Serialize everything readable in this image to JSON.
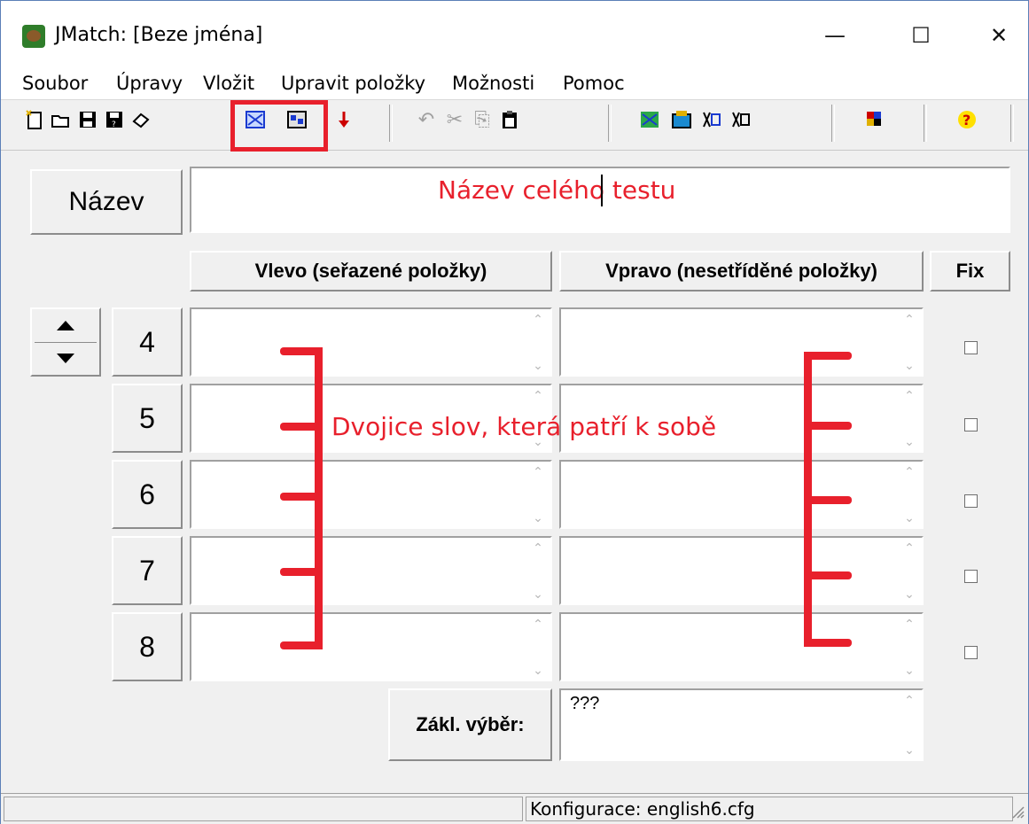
{
  "window": {
    "title": "JMatch: [Beze jména]",
    "minimize_glyph": "—",
    "maximize_glyph": "☐",
    "close_glyph": "✕"
  },
  "menu": [
    "Soubor",
    "Úpravy",
    "Vložit",
    "Upravit položky",
    "Možnosti",
    "Pomoc"
  ],
  "toolbar": {
    "icons": [
      "new-file-icon",
      "open-folder-icon",
      "save-icon",
      "save-as-icon",
      "eraser-icon",
      "create-web-page-icon",
      "create-web-page-alt-icon",
      "down-arrow-icon",
      "undo-icon",
      "cut-icon",
      "copy-icon",
      "paste-icon",
      "web-export-icon",
      "image-icon",
      "export-icon",
      "export-alt-icon",
      "config-icon",
      "help-icon"
    ]
  },
  "title_row": {
    "label": "Název",
    "value": "Název celého testu"
  },
  "headers": {
    "left": "Vlevo (seřazené položky)",
    "right": "Vpravo (nesetříděné položky)",
    "fix": "Fix"
  },
  "rows": [
    {
      "number": "4",
      "left": "",
      "right": "",
      "fixed": false
    },
    {
      "number": "5",
      "left": "",
      "right": "",
      "fixed": false
    },
    {
      "number": "6",
      "left": "",
      "right": "",
      "fixed": false
    },
    {
      "number": "7",
      "left": "",
      "right": "",
      "fixed": false
    },
    {
      "number": "8",
      "left": "",
      "right": "",
      "fixed": false
    }
  ],
  "annotation": "Dvojice slov, která patří k sobě",
  "default_choice": {
    "label": "Zákl. výběr:",
    "value": "???"
  },
  "status": {
    "config": "Konfigurace: english6.cfg"
  },
  "colors": {
    "annotation_red": "#e8202c",
    "toolbar_highlight": "#e8202c"
  }
}
